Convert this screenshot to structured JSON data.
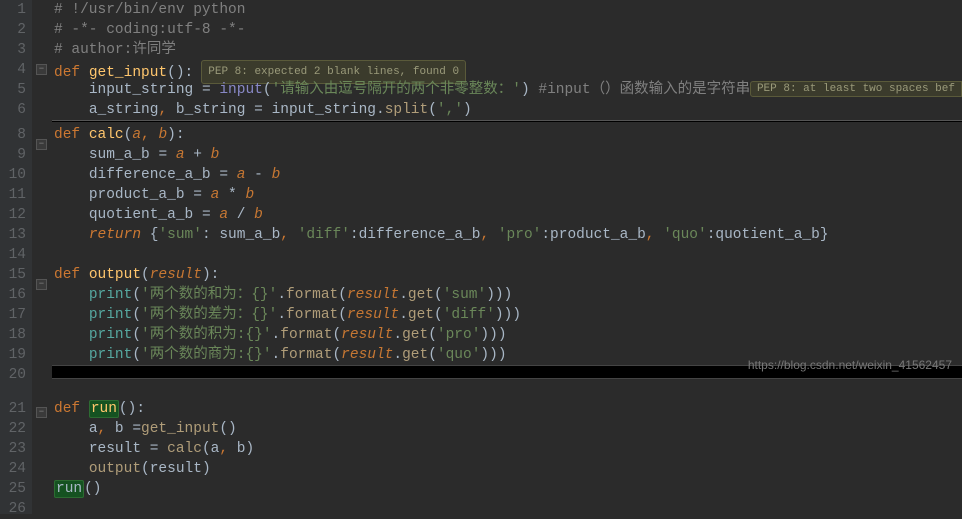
{
  "gutter_lines": [
    "1",
    "2",
    "3",
    "4",
    "5",
    "6",
    "8",
    "9",
    "10",
    "11",
    "12",
    "13",
    "14",
    "15",
    "16",
    "17",
    "18",
    "19",
    "20",
    "21",
    "22",
    "23",
    "24",
    "25",
    "26"
  ],
  "code": {
    "l1_cmt": "# !/usr/bin/env python",
    "l2_cmt": "# -*- coding:utf-8 -*-",
    "l3_cmt": "# author:许同学",
    "l4_kw": "def ",
    "l4_fn": "get_input",
    "l4_rest": "():",
    "l4_hint": "PEP 8: expected 2 blank lines, found 0",
    "l5_var": "input_string ",
    "l5_eq": "= ",
    "l5_bi": "input",
    "l5_p1": "(",
    "l5_str": "'请输入由逗号隔开的两个非零整数：'",
    "l5_p2": ") ",
    "l5_cmt": "#input（）函数输入的是字符串",
    "l5_hint_right": "PEP 8: at least two spaces bef",
    "l6_a": "a_string",
    "l6_c1": ", ",
    "l6_b": "b_string ",
    "l6_eq": "= ",
    "l6_is": "input_string",
    "l6_dot": ".",
    "l6_split": "split",
    "l6_arg": "(",
    "l6_argstr": "','",
    "l6_arg2": ")",
    "l9_kw": "def ",
    "l9_fn": "calc",
    "l9_p1": "(",
    "l9_a": "a",
    "l9_c": ", ",
    "l9_b": "b",
    "l9_p2": "):",
    "l10": "sum_a_b ",
    "l10_eq": "= ",
    "l10_a": "a ",
    "l10_op": "+ ",
    "l10_b": "b",
    "l11": "difference_a_b ",
    "l11_eq": "= ",
    "l11_a": "a ",
    "l11_op": "- ",
    "l11_b": "b",
    "l12": "product_a_b ",
    "l12_eq": "= ",
    "l12_a": "a ",
    "l12_op": "* ",
    "l12_b": "b",
    "l13": "quotient_a_b ",
    "l13_eq": "= ",
    "l13_a": "a ",
    "l13_op": "/ ",
    "l13_b": "b",
    "l14_kw": "return ",
    "l14_o": "{",
    "l14_k1": "'sum'",
    "l14_c": ": ",
    "l14_v1": "sum_a_b",
    "l14_s": ", ",
    "l14_k2": "'diff'",
    "l14_v2": ":difference_a_b",
    "l14_k3": "'pro'",
    "l14_v3": ":product_a_b",
    "l14_k4": "'quo'",
    "l14_v4": ":quotient_a_b",
    "l14_e": "}",
    "l16_kw": "def ",
    "l16_fn": "output",
    "l16_p1": "(",
    "l16_r": "result",
    "l16_p2": "):",
    "l17_pr": "print",
    "l17_p1": "(",
    "l17_s": "'两个数的和为：{}'",
    "l17_dot": ".",
    "l17_fmt": "format",
    "l17_p2": "(",
    "l17_r": "result",
    "l17_dot2": ".",
    "l17_get": "get",
    "l17_p3": "(",
    "l17_key": "'sum'",
    "l17_end": ")))",
    "l18_s": "'两个数的差为：{}'",
    "l18_key": "'diff'",
    "l19_s": "'两个数的积为:{}'",
    "l19_key": "'pro'",
    "l20_s": "'两个数的商为:{}'",
    "l20_key": "'quo'",
    "l22_kw": "def ",
    "l22_fn": "run",
    "l22_rest": "():",
    "l23_ab": "a",
    "l23_c": ", ",
    "l23_b": "b ",
    "l23_eq": "=",
    "l23_gi": "get_input",
    "l23_p": "()",
    "l24_r": "result ",
    "l24_eq": "= ",
    "l24_c": "calc",
    "l24_p": "(a",
    "l24_cm": ", ",
    "l24_b2": "b)",
    "l25_o": "output",
    "l25_p": "(result)",
    "l26_r": "run",
    "l26_p": "()"
  },
  "watermark": "https://blog.csdn.net/weixin_41562457"
}
